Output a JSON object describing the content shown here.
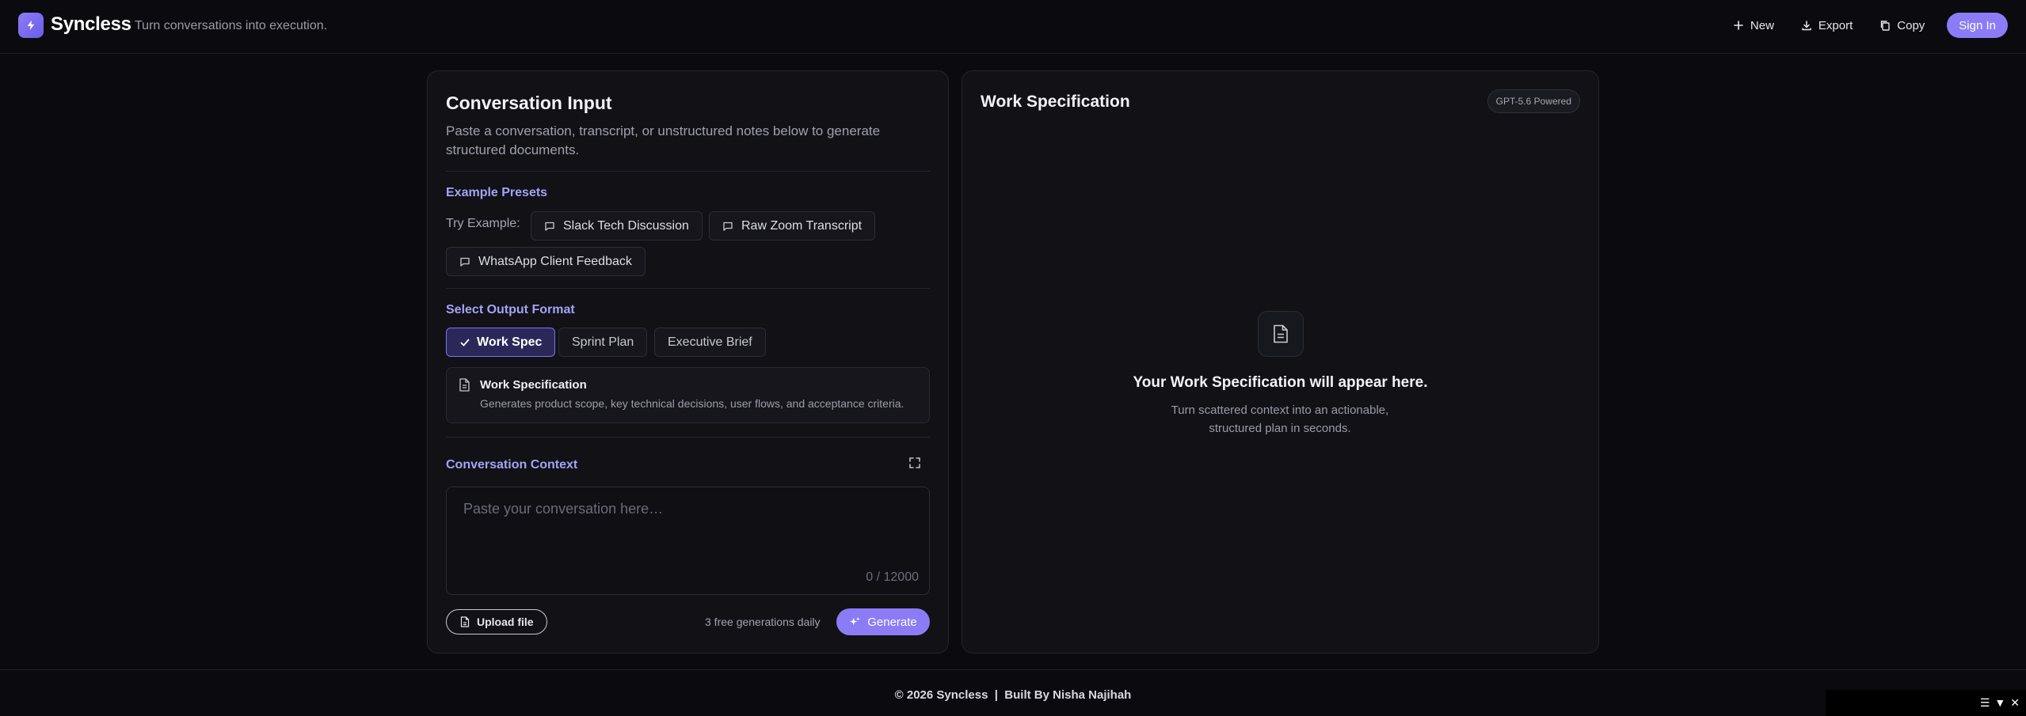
{
  "header": {
    "brand": "Syncless",
    "tagline": "Turn conversations into execution.",
    "actions": {
      "new_label": "New",
      "export_label": "Export",
      "copy_label": "Copy",
      "signin_label": "Sign In"
    }
  },
  "input_panel": {
    "title": "Conversation Input",
    "subtitle": "Paste a conversation, transcript, or unstructured notes below to generate structured documents.",
    "presets": {
      "section_label": "Example Presets",
      "try_label": "Try Example:",
      "items": [
        "Slack Tech Discussion",
        "Raw Zoom Transcript",
        "WhatsApp Client Feedback"
      ]
    },
    "format": {
      "section_label": "Select Output Format",
      "options": [
        "Work Spec",
        "Sprint Plan",
        "Executive Brief"
      ],
      "selected": "Work Spec",
      "info_title": "Work Specification",
      "info_desc": "Generates product scope, key technical decisions, user flows, and acceptance criteria."
    },
    "context": {
      "section_label": "Conversation Context",
      "placeholder": "Paste your conversation here…",
      "char_count": "0 / 12000"
    },
    "upload_label": "Upload file",
    "free_note": "3 free generations daily",
    "generate_label": "Generate"
  },
  "output_panel": {
    "title": "Work Specification",
    "badge": "GPT-5.6 Powered",
    "empty_title": "Your Work Specification will appear here.",
    "empty_desc": "Turn scattered context into an actionable, structured plan in seconds."
  },
  "footer": {
    "text": "© 2026 Syncless  |  Built By Nisha Najihah"
  },
  "colors": {
    "accent": "#8b7cf6",
    "background": "#0b0b0f",
    "card": "#111116",
    "section_label": "#a7a2f7"
  }
}
